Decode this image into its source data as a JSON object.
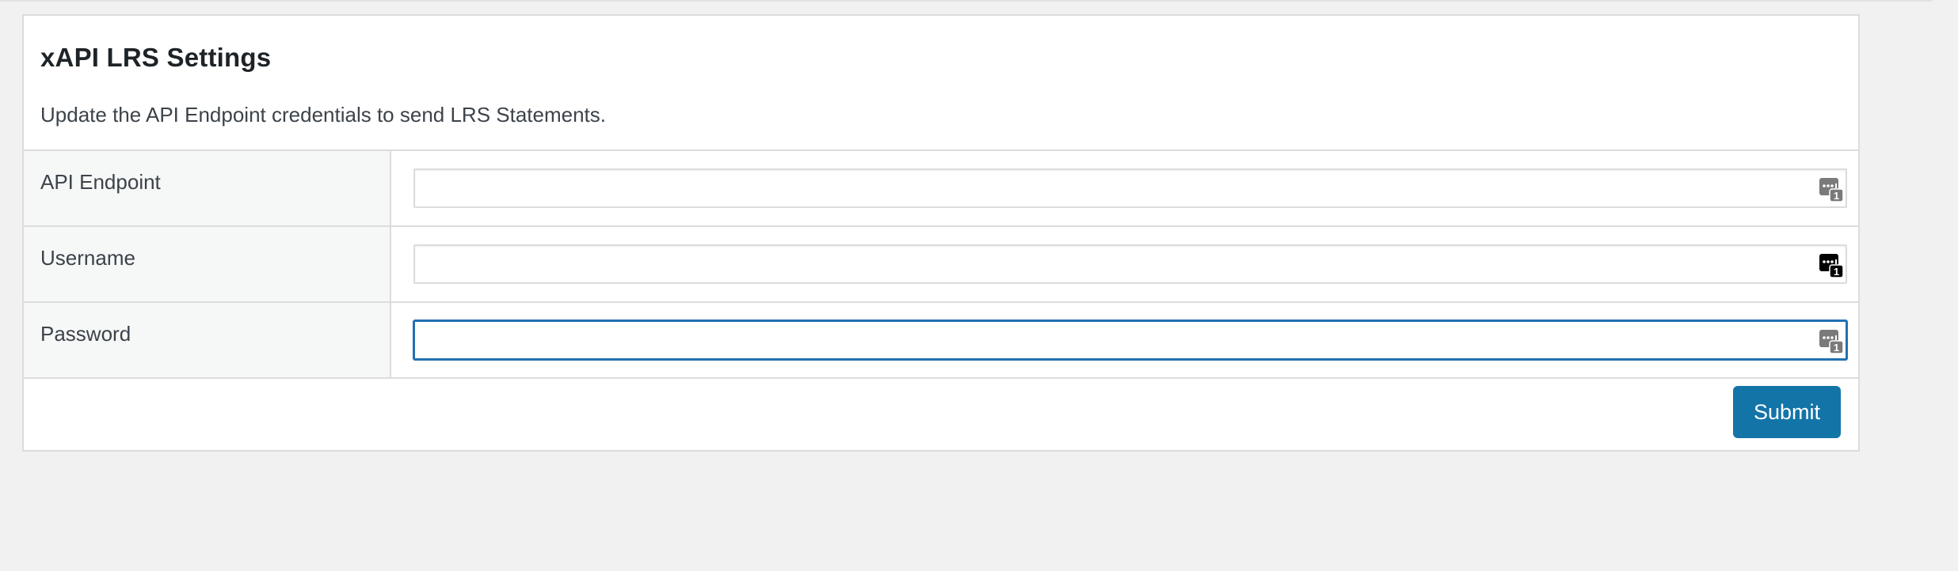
{
  "panel": {
    "title": "xAPI LRS Settings",
    "description": "Update the API Endpoint credentials to send LRS Statements."
  },
  "fields": [
    {
      "label": "API Endpoint",
      "value": "",
      "icon": "password-manager-icon",
      "icon_state": "gray"
    },
    {
      "label": "Username",
      "value": "",
      "icon": "password-manager-icon",
      "icon_state": "black"
    },
    {
      "label": "Password",
      "value": "",
      "icon": "password-manager-icon",
      "icon_state": "gray",
      "focused": true
    }
  ],
  "submit": {
    "label": "Submit"
  },
  "colors": {
    "accent": "#1374a8",
    "focus_border": "#2271b1",
    "icon_gray": "#7a7a7a",
    "icon_black": "#000000"
  }
}
